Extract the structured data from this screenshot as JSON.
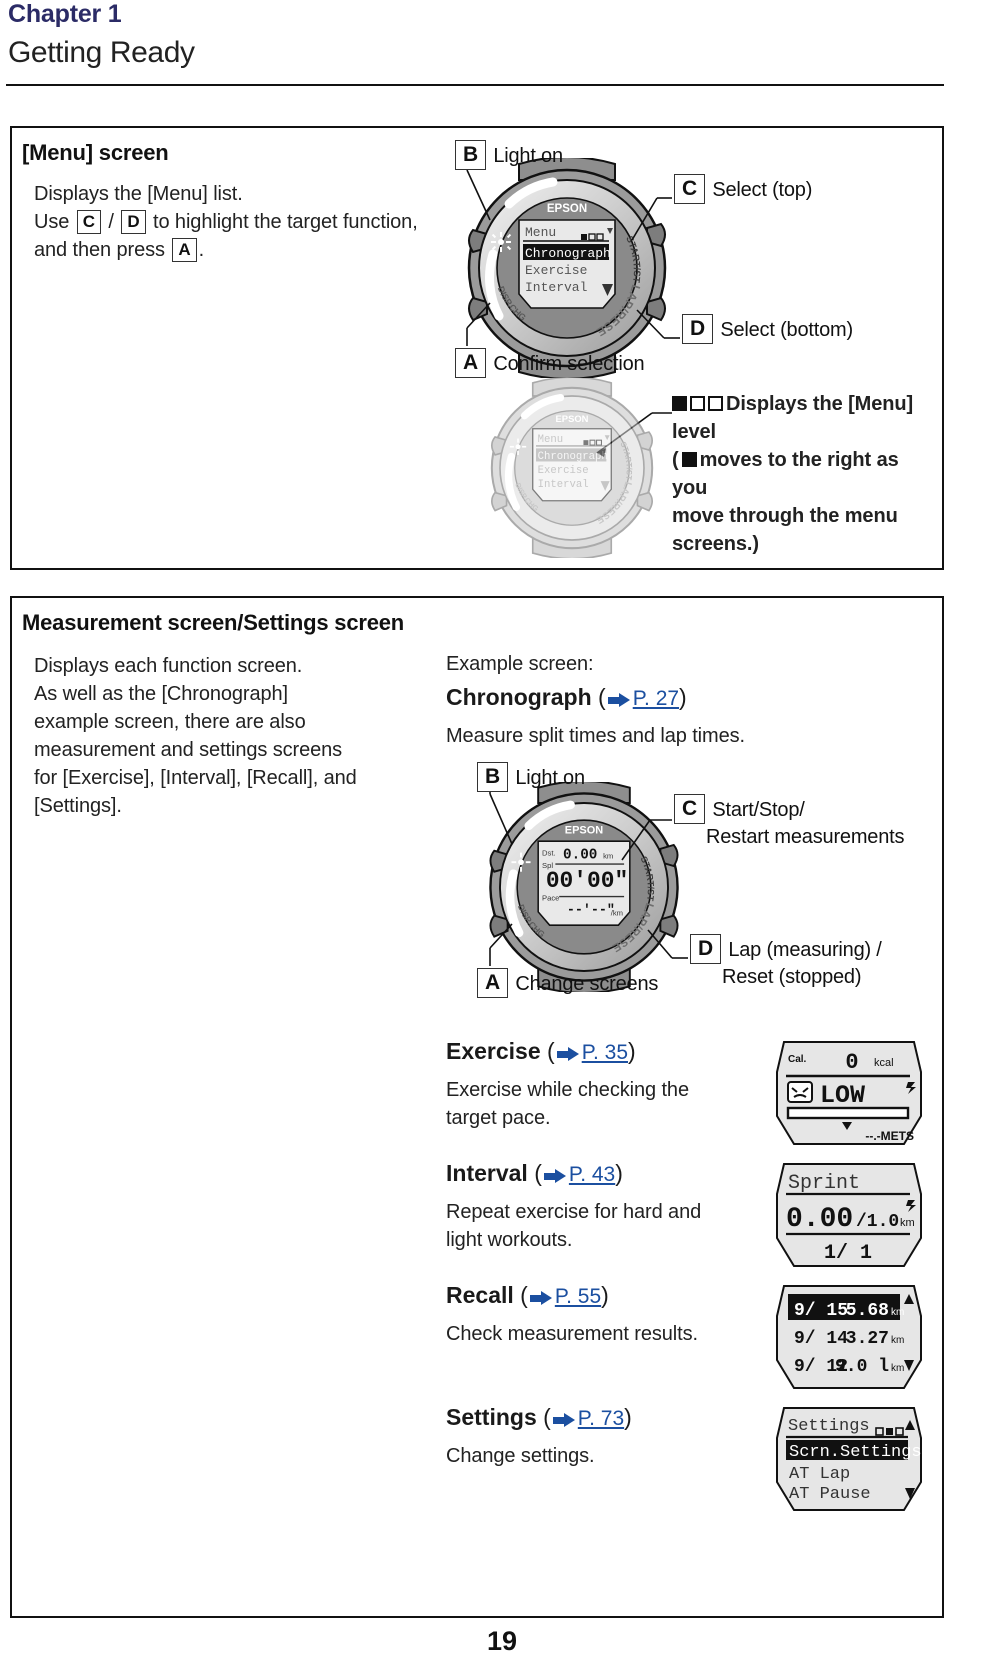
{
  "header": {
    "chapter": "Chapter 1",
    "title": "Getting Ready"
  },
  "page_number": "19",
  "menu_section": {
    "heading": "[Menu] screen",
    "desc_line1": "Displays the [Menu] list.",
    "desc_line2_a": "Use",
    "key_c": "C",
    "sep": "/",
    "key_d": "D",
    "desc_line2_b": "to highlight the target function,",
    "desc_line3_a": "and then press",
    "key_a": "A",
    "desc_line3_b": ".",
    "callouts": {
      "b_key": "B",
      "b_label": "Light on",
      "c_key": "C",
      "c_label": "Select (top)",
      "d_key": "D",
      "d_label": "Select (bottom)",
      "a_key": "A",
      "a_label": "Confirm selection"
    },
    "level_note": {
      "line1": "Displays the [Menu] level",
      "line2_a": "(",
      "line2_b": "moves to the right as you",
      "line3": "move through the menu screens.)"
    },
    "watch_screen": {
      "brand": "EPSON",
      "title": "Menu",
      "items": [
        "Chronograph",
        "Exercise",
        "Interval"
      ],
      "highlighted_index": 0,
      "bezel_labels": [
        "START/STOP",
        "LAP/RESET",
        "DISP.CHG"
      ]
    }
  },
  "measurement_section": {
    "heading": "Measurement screen/Settings screen",
    "desc": [
      "Displays each function screen.",
      "As well as the [Chronograph]",
      "example screen, there are also",
      "measurement and settings screens",
      "for [Exercise], [Interval], [Recall], and",
      "[Settings]."
    ],
    "example_label": "Example screen:",
    "chronograph": {
      "title": "Chronograph",
      "page_ref": "P. 27",
      "desc": "Measure split times and lap times.",
      "callouts": {
        "b_key": "B",
        "b_label": "Light on",
        "c_key": "C",
        "c_label_l1": "Start/Stop/",
        "c_label_l2": "Restart measurements",
        "d_key": "D",
        "d_label_l1": "Lap (measuring) /",
        "d_label_l2": "Reset (stopped)",
        "a_key": "A",
        "a_label": "Change screens"
      },
      "watch_screen": {
        "brand": "EPSON",
        "row1_label": "Dst.",
        "row1_value": "0.00",
        "row1_unit": "km",
        "row2_label": "Spl",
        "row2_value": "00'00\"",
        "row3_label": "Pace",
        "row3_value": "--'--\"",
        "row3_unit": "/km"
      }
    },
    "entries": [
      {
        "title": "Exercise",
        "page_ref": "P. 35",
        "desc_l1": "Exercise while checking the",
        "desc_l2": "target pace.",
        "screen": {
          "type": "exercise",
          "cal_label": "Cal.",
          "cal_value": "0",
          "cal_unit": "kcal",
          "status": "LOW",
          "mets_value": "--.-",
          "mets_unit": "METS"
        }
      },
      {
        "title": "Interval",
        "page_ref": "P. 43",
        "desc_l1": "Repeat exercise for hard and",
        "desc_l2": "light workouts.",
        "screen": {
          "type": "interval",
          "mode": "Sprint",
          "dist_value": "0.00",
          "dist_total": "/1.0",
          "dist_unit": "km",
          "lap_counter": "1/ 1"
        }
      },
      {
        "title": "Recall",
        "page_ref": "P. 55",
        "desc_l1": "Check measurement results.",
        "desc_l2": "",
        "screen": {
          "type": "recall",
          "rows": [
            {
              "date": "9/ 15",
              "dist": "5.68",
              "unit": "km",
              "selected": true
            },
            {
              "date": "9/ 14",
              "dist": "3.27",
              "unit": "km",
              "selected": false
            },
            {
              "date": "9/ 12",
              "dist": "9.0 l",
              "unit": "km",
              "selected": false
            }
          ]
        }
      },
      {
        "title": "Settings",
        "page_ref": "P. 73",
        "desc_l1": "Change settings.",
        "desc_l2": "",
        "screen": {
          "type": "settings",
          "title": "Settings",
          "items": [
            "Scrn. Settings",
            "AT Lap",
            "AT Pause"
          ],
          "highlighted_index": 0
        }
      }
    ]
  },
  "colors": {
    "chapter_blue": "#2b2b66",
    "link_blue": "#1b4fa0",
    "rule": "#111111"
  }
}
